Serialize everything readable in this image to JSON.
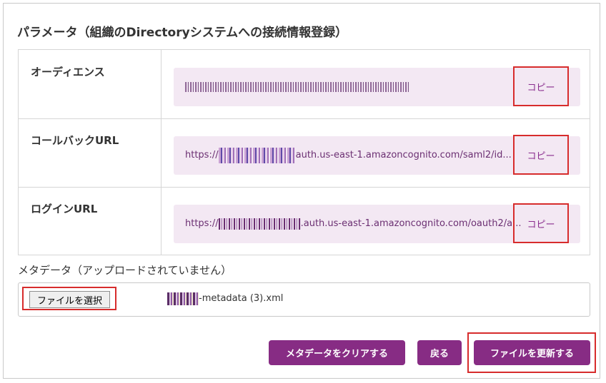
{
  "section_title": "パラメータ（組織のDirectoryシステムへの接続情報登録）",
  "rows": [
    {
      "label": "オーディエンス",
      "value_prefix": "",
      "value_suffix": "",
      "copy_label": "コピー"
    },
    {
      "label": "コールバックURL",
      "value_prefix": "https://",
      "value_suffix": "auth.us-east-1.amazoncognito.com/saml2/id...",
      "copy_label": "コピー"
    },
    {
      "label": "ログインURL",
      "value_prefix": "https://",
      "value_suffix": ".auth.us-east-1.amazoncognito.com/oauth2/a...",
      "copy_label": "コピー"
    }
  ],
  "metadata": {
    "label": "メタデータ（アップロードされていません）",
    "file_button": "ファイルを選択",
    "file_name_suffix": "-metadata (3).xml"
  },
  "buttons": {
    "clear": "メタデータをクリアする",
    "back": "戻る",
    "update": "ファイルを更新する"
  },
  "colors": {
    "accent": "#872c84",
    "value_bg": "#f3e8f3",
    "highlight": "#d72c2c"
  }
}
